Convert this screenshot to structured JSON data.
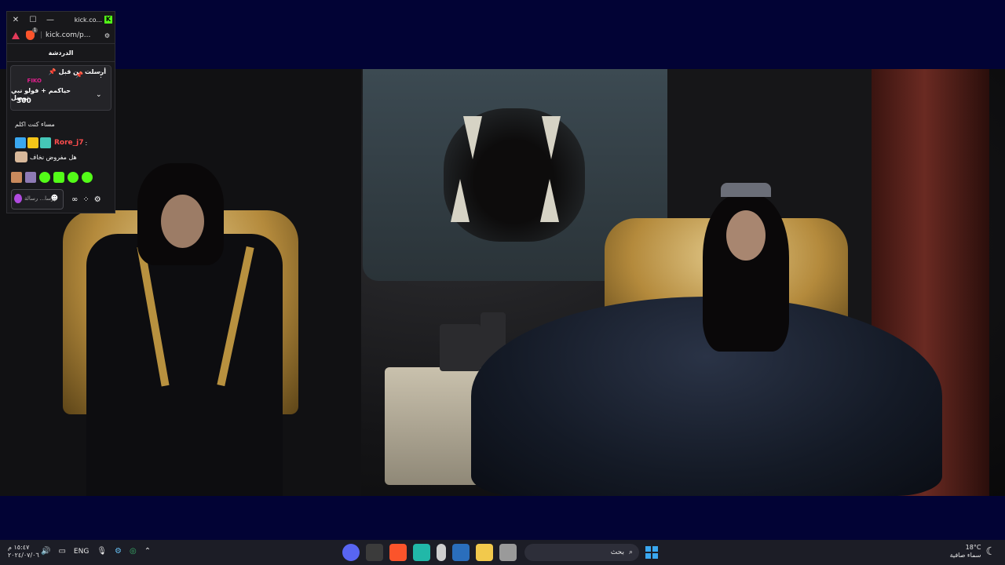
{
  "popup": {
    "window_title": "kick.co...",
    "close_glyph": "✕",
    "max_glyph": "☐",
    "min_glyph": "—",
    "address": "kick.com/p...",
    "shield_count": "1",
    "chat_header": "الدردشة",
    "pinned": {
      "sent_by_label": "أرسلت من قبل",
      "author": "FIKO",
      "message": "حياكمم + فولو نبي نوصل",
      "number": "300"
    },
    "messages": [
      {
        "text": "مساء كنت اكلم"
      },
      {
        "username": "Rore_j7",
        "colon": ":",
        "text": "هل مفروض نخاف"
      }
    ],
    "input_placeholder": "إرسا... رسالة"
  },
  "taskbar": {
    "clock_time": "١٥:٤٧",
    "clock_ampm": "م",
    "clock_date": "٢٠٢٤/٠٧/٠٦",
    "language": "ENG",
    "search_placeholder": "بحث",
    "temperature": "18°C",
    "weather_desc": "سماء صافية"
  },
  "colors": {
    "background": "#020335",
    "kick_green": "#53fc18",
    "taskbar": "#1c1d26",
    "pinned_author": "#e01f8c",
    "username": "#ff4d4d"
  }
}
